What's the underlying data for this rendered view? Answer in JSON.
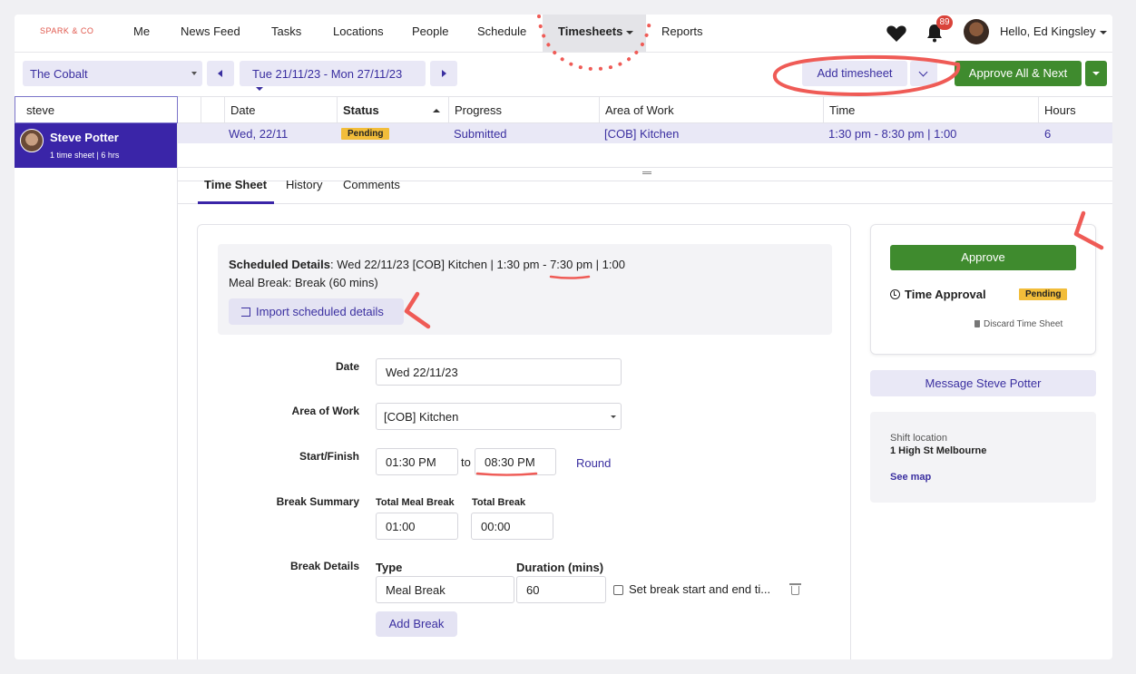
{
  "brand": "SPARK & CO",
  "nav": {
    "items": [
      "Me",
      "News Feed",
      "Tasks",
      "Locations",
      "People",
      "Schedule",
      "Timesheets",
      "Reports"
    ],
    "active": "Timesheets",
    "notification_count": "89",
    "greeting": "Hello, Ed Kingsley"
  },
  "toolbar": {
    "location": "The Cobalt",
    "date_range": "Tue 21/11/23 - Mon 27/11/23",
    "add_timesheet": "Add timesheet",
    "approve_all": "Approve All & Next"
  },
  "search": {
    "value": "steve"
  },
  "person": {
    "name": "Steve Potter",
    "summary": "1 time sheet | 6 hrs"
  },
  "table": {
    "headers": [
      "Date",
      "Status",
      "Progress",
      "Area of Work",
      "Time",
      "Hours"
    ],
    "row": {
      "date": "Wed, 22/11",
      "status": "Pending",
      "progress": "Submitted",
      "area": "[COB] Kitchen",
      "time": "1:30 pm - 8:30 pm | 1:00",
      "hours": "6"
    }
  },
  "tabs": [
    "Time Sheet",
    "History",
    "Comments"
  ],
  "scheduled": {
    "label": "Scheduled Details",
    "details_a": ": Wed 22/11/23 [COB] Kitchen | 1:30 pm - ",
    "details_b": "7:30 pm",
    "details_c": " | 1:00",
    "meal_break": "Meal Break: Break (60 mins)",
    "import_button": "Import scheduled details"
  },
  "form": {
    "date_label": "Date",
    "date_value": "Wed 22/11/23",
    "area_label": "Area of Work",
    "area_value": "[COB] Kitchen",
    "startfinish_label": "Start/Finish",
    "start_value": "01:30 PM",
    "to_text": "to",
    "finish_value": "08:30 PM",
    "round_link": "Round",
    "break_summary_label": "Break Summary",
    "total_meal_break_label": "Total Meal Break",
    "total_meal_break_value": "01:00",
    "total_break_label": "Total Break",
    "total_break_value": "00:00",
    "break_details_label": "Break Details",
    "type_label": "Type",
    "type_value": "Meal Break",
    "duration_label": "Duration (mins)",
    "duration_value": "60",
    "set_break_label": "Set break start and end ti...",
    "add_break": "Add Break"
  },
  "approval": {
    "approve_button": "Approve",
    "time_approval": "Time Approval",
    "status": "Pending",
    "discard": "Discard Time Sheet",
    "message_button": "Message Steve Potter",
    "shift_location_label": "Shift location",
    "shift_location_value": "1 High St Melbourne",
    "see_map": "See map"
  },
  "colors": {
    "primary": "#3a25a8",
    "approve_green": "#3f8b2e",
    "pending_yellow": "#f2bd3a",
    "annotation_red": "#ef5b56"
  }
}
